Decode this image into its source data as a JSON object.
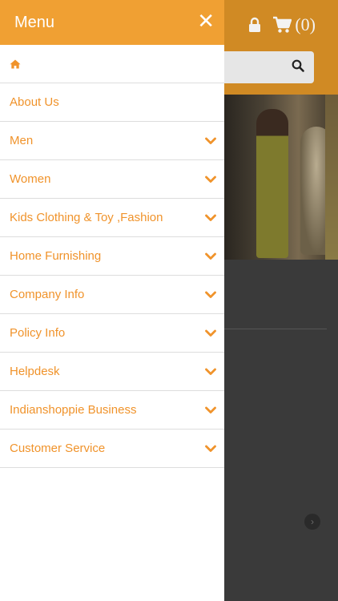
{
  "header": {
    "cart_count": "(0)",
    "lock_icon": "lock-icon",
    "cart_icon": "cart-icon",
    "search_icon": "search-icon"
  },
  "drawer": {
    "title": "Menu",
    "close_icon": "close-icon",
    "items": [
      {
        "icon": "home-icon",
        "label": "",
        "has_submenu": false
      },
      {
        "label": "About Us",
        "has_submenu": false
      },
      {
        "label": "Men",
        "has_submenu": true
      },
      {
        "label": "Women",
        "has_submenu": true
      },
      {
        "label": "Kids Clothing & Toy ,Fashion",
        "has_submenu": true
      },
      {
        "label": "Home Furnishing",
        "has_submenu": true
      },
      {
        "label": "Company Info",
        "has_submenu": true
      },
      {
        "label": "Policy Info",
        "has_submenu": true
      },
      {
        "label": "Helpdesk",
        "has_submenu": true
      },
      {
        "label": "Indianshoppie Business",
        "has_submenu": true
      },
      {
        "label": "Customer Service",
        "has_submenu": true
      }
    ]
  },
  "colors": {
    "accent": "#f0a033",
    "menu_text": "#f0932b",
    "overlay": "#3a3a3a"
  }
}
